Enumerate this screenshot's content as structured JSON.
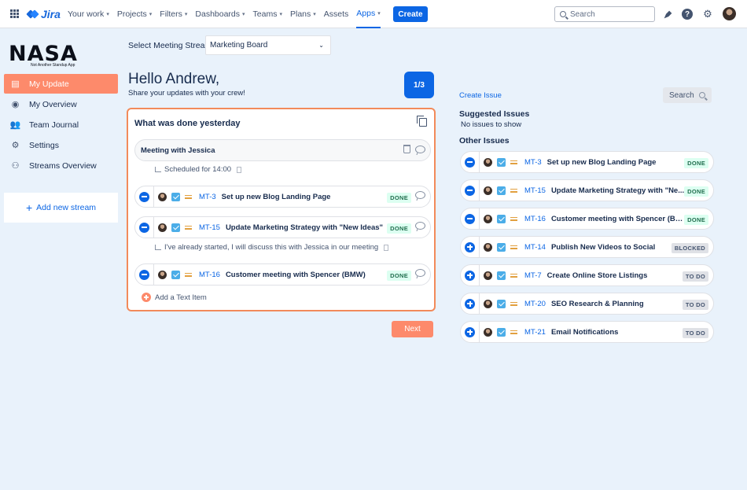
{
  "topnav": {
    "brand": "Jira",
    "items": [
      {
        "label": "Your work",
        "chevron": true
      },
      {
        "label": "Projects",
        "chevron": true
      },
      {
        "label": "Filters",
        "chevron": true
      },
      {
        "label": "Dashboards",
        "chevron": true
      },
      {
        "label": "Teams",
        "chevron": true
      },
      {
        "label": "Plans",
        "chevron": true
      },
      {
        "label": "Assets",
        "chevron": false
      },
      {
        "label": "Apps",
        "chevron": true,
        "active": true
      }
    ],
    "create_label": "Create",
    "search_placeholder": "Search"
  },
  "sidebar": {
    "logo_text": "NASA",
    "logo_sub": "Not Another Standup App",
    "items": [
      {
        "label": "My Update",
        "icon": "document-icon",
        "active": true
      },
      {
        "label": "My Overview",
        "icon": "user-circle-icon"
      },
      {
        "label": "Team Journal",
        "icon": "people-icon"
      },
      {
        "label": "Settings",
        "icon": "gear-icon"
      },
      {
        "label": "Streams Overview",
        "icon": "hierarchy-icon"
      }
    ],
    "add_stream_label": "Add new stream"
  },
  "main": {
    "stream_label": "Select Meeting Stream",
    "stream_value": "Marketing Board",
    "greeting": "Hello Andrew,",
    "greeting_sub": "Share your updates with your crew!",
    "pager": "1/3",
    "card": {
      "title": "What was done yesterday",
      "text_item": {
        "title": "Meeting with Jessica",
        "note": "Scheduled for 14:00"
      },
      "issues": [
        {
          "key": "MT-3",
          "summary": "Set up new Blog Landing Page",
          "status": "DONE"
        },
        {
          "key": "MT-15",
          "summary": "Update Marketing Strategy with \"New Ideas\"",
          "status": "DONE",
          "note": "I've already started, I will discuss this with Jessica in our meeting"
        },
        {
          "key": "MT-16",
          "summary": "Customer meeting with Spencer (BMW)",
          "status": "DONE"
        }
      ],
      "add_text_label": "Add a Text Item"
    },
    "next_label": "Next"
  },
  "right": {
    "create_issue": "Create Issue",
    "search_label": "Search",
    "suggested_title": "Suggested Issues",
    "suggested_empty": "No issues to show",
    "other_title": "Other Issues",
    "issues": [
      {
        "key": "MT-3",
        "summary": "Set up new Blog Landing Page",
        "status": "DONE",
        "action": "remove"
      },
      {
        "key": "MT-15",
        "summary": "Update Marketing Strategy with \"Ne...",
        "status": "DONE",
        "action": "remove"
      },
      {
        "key": "MT-16",
        "summary": "Customer meeting with Spencer (BMW)",
        "status": "DONE",
        "action": "remove"
      },
      {
        "key": "MT-14",
        "summary": "Publish New Videos to Social",
        "status": "BLOCKED",
        "action": "add"
      },
      {
        "key": "MT-7",
        "summary": "Create Online Store Listings",
        "status": "TO DO",
        "action": "add"
      },
      {
        "key": "MT-20",
        "summary": "SEO Research & Planning",
        "status": "TO DO",
        "action": "add"
      },
      {
        "key": "MT-21",
        "summary": "Email Notifications",
        "status": "TO DO",
        "action": "add"
      }
    ]
  }
}
